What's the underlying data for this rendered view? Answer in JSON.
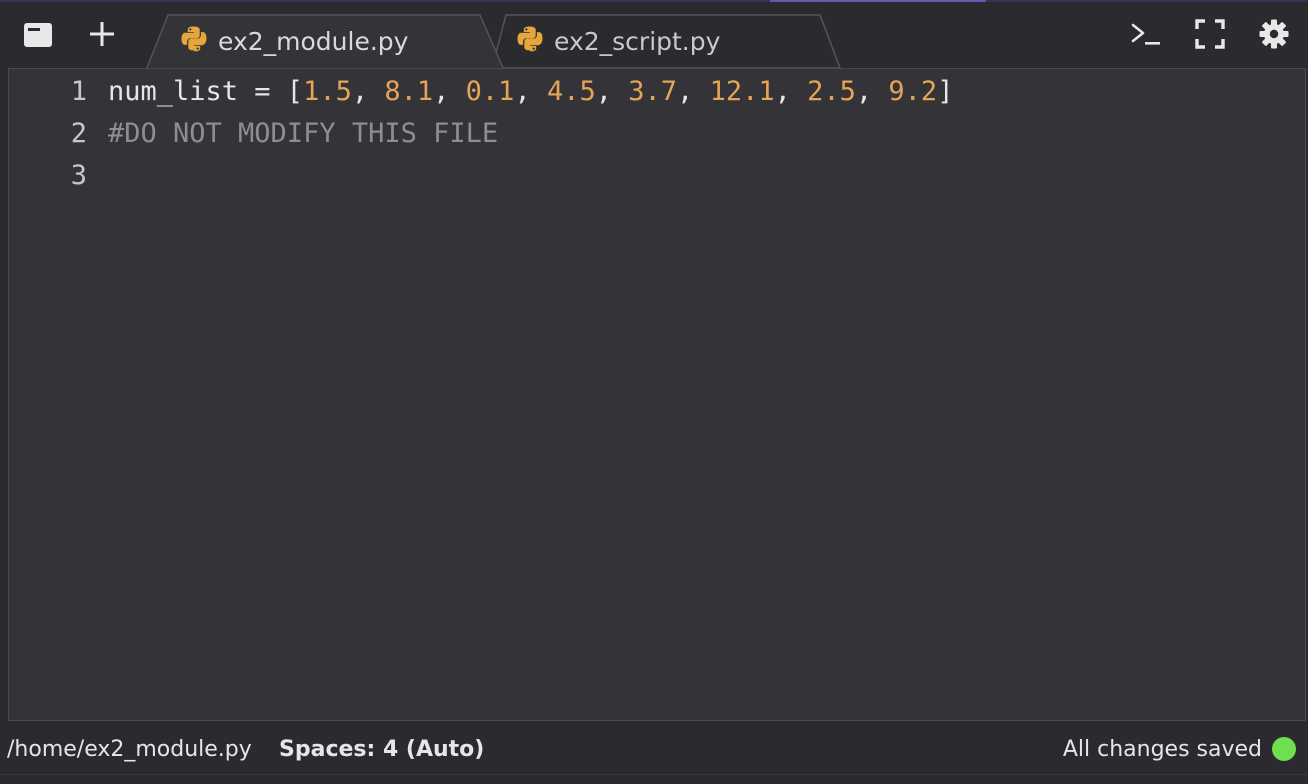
{
  "tabs": [
    {
      "label": "ex2_module.py",
      "icon": "python-icon",
      "active": true
    },
    {
      "label": "ex2_script.py",
      "icon": "python-icon",
      "active": false
    }
  ],
  "toolbar": {
    "left_icons": [
      "sidebar-toggle-icon",
      "plus-icon"
    ],
    "right_icons": [
      "terminal-icon",
      "fullscreen-icon",
      "gear-icon"
    ]
  },
  "editor": {
    "lines": [
      {
        "number": "1",
        "tokens": [
          {
            "text": "num_list = [",
            "kind": "plain"
          },
          {
            "text": "1.5",
            "kind": "num"
          },
          {
            "text": ", ",
            "kind": "plain"
          },
          {
            "text": "8.1",
            "kind": "num"
          },
          {
            "text": ", ",
            "kind": "plain"
          },
          {
            "text": "0.1",
            "kind": "num"
          },
          {
            "text": ", ",
            "kind": "plain"
          },
          {
            "text": "4.5",
            "kind": "num"
          },
          {
            "text": ", ",
            "kind": "plain"
          },
          {
            "text": "3.7",
            "kind": "num"
          },
          {
            "text": ", ",
            "kind": "plain"
          },
          {
            "text": "12.1",
            "kind": "num"
          },
          {
            "text": ", ",
            "kind": "plain"
          },
          {
            "text": "2.5",
            "kind": "num"
          },
          {
            "text": ", ",
            "kind": "plain"
          },
          {
            "text": "9.2",
            "kind": "num"
          },
          {
            "text": "]",
            "kind": "plain"
          }
        ]
      },
      {
        "number": "2",
        "tokens": [
          {
            "text": "#DO NOT MODIFY THIS FILE",
            "kind": "comment"
          }
        ]
      },
      {
        "number": "3",
        "tokens": []
      }
    ]
  },
  "status": {
    "path": "/home/ex2_module.py",
    "spaces": "Spaces: 4 (Auto)",
    "saved": "All changes saved"
  },
  "colors": {
    "accent": "#6a55b0",
    "number": "#e5a457",
    "comment": "#8e8e8e",
    "saved_dot": "#6ee04f"
  }
}
